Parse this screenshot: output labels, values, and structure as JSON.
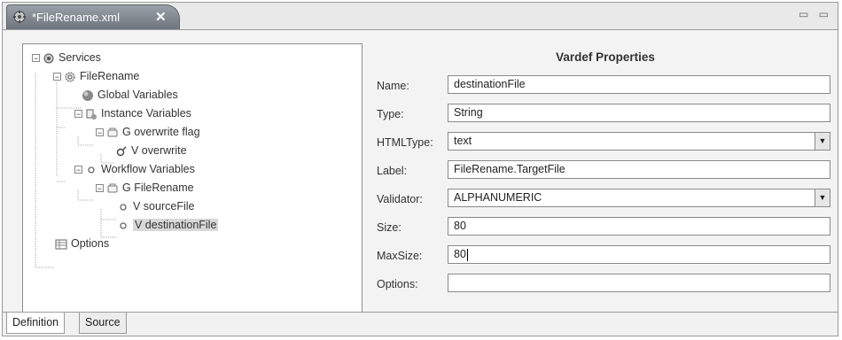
{
  "editor_tab": {
    "title": "*FileRename.xml",
    "close": "✕",
    "window_controls": "▭ ▭"
  },
  "tree": {
    "items": [
      {
        "label": "Services"
      },
      {
        "label": "FileRename"
      },
      {
        "label": "Global Variables"
      },
      {
        "label": "Instance Variables"
      },
      {
        "label": "G overwrite flag"
      },
      {
        "label": "V overwrite"
      },
      {
        "label": "Workflow Variables"
      },
      {
        "label": "G FileRename"
      },
      {
        "label": "V sourceFile"
      },
      {
        "label": "V destinationFile"
      },
      {
        "label": "Options"
      }
    ]
  },
  "props": {
    "title": "Vardef Properties",
    "name_label": "Name:",
    "name_value": "destinationFile",
    "type_label": "Type:",
    "type_value": "String",
    "htmltype_label": "HTMLType:",
    "htmltype_value": "text",
    "label_label": "Label:",
    "label_value": "FileRename.TargetFile",
    "validator_label": "Validator:",
    "validator_value": "ALPHANUMERIC",
    "size_label": "Size:",
    "size_value": "80",
    "maxsize_label": "MaxSize:",
    "maxsize_value": "80",
    "options_label": "Options:",
    "options_value": ""
  },
  "bottom_tabs": {
    "definition": "Definition",
    "source": "Source"
  },
  "colors": {
    "tab_active": "#7b8189",
    "selection": "#d8d8d8"
  }
}
